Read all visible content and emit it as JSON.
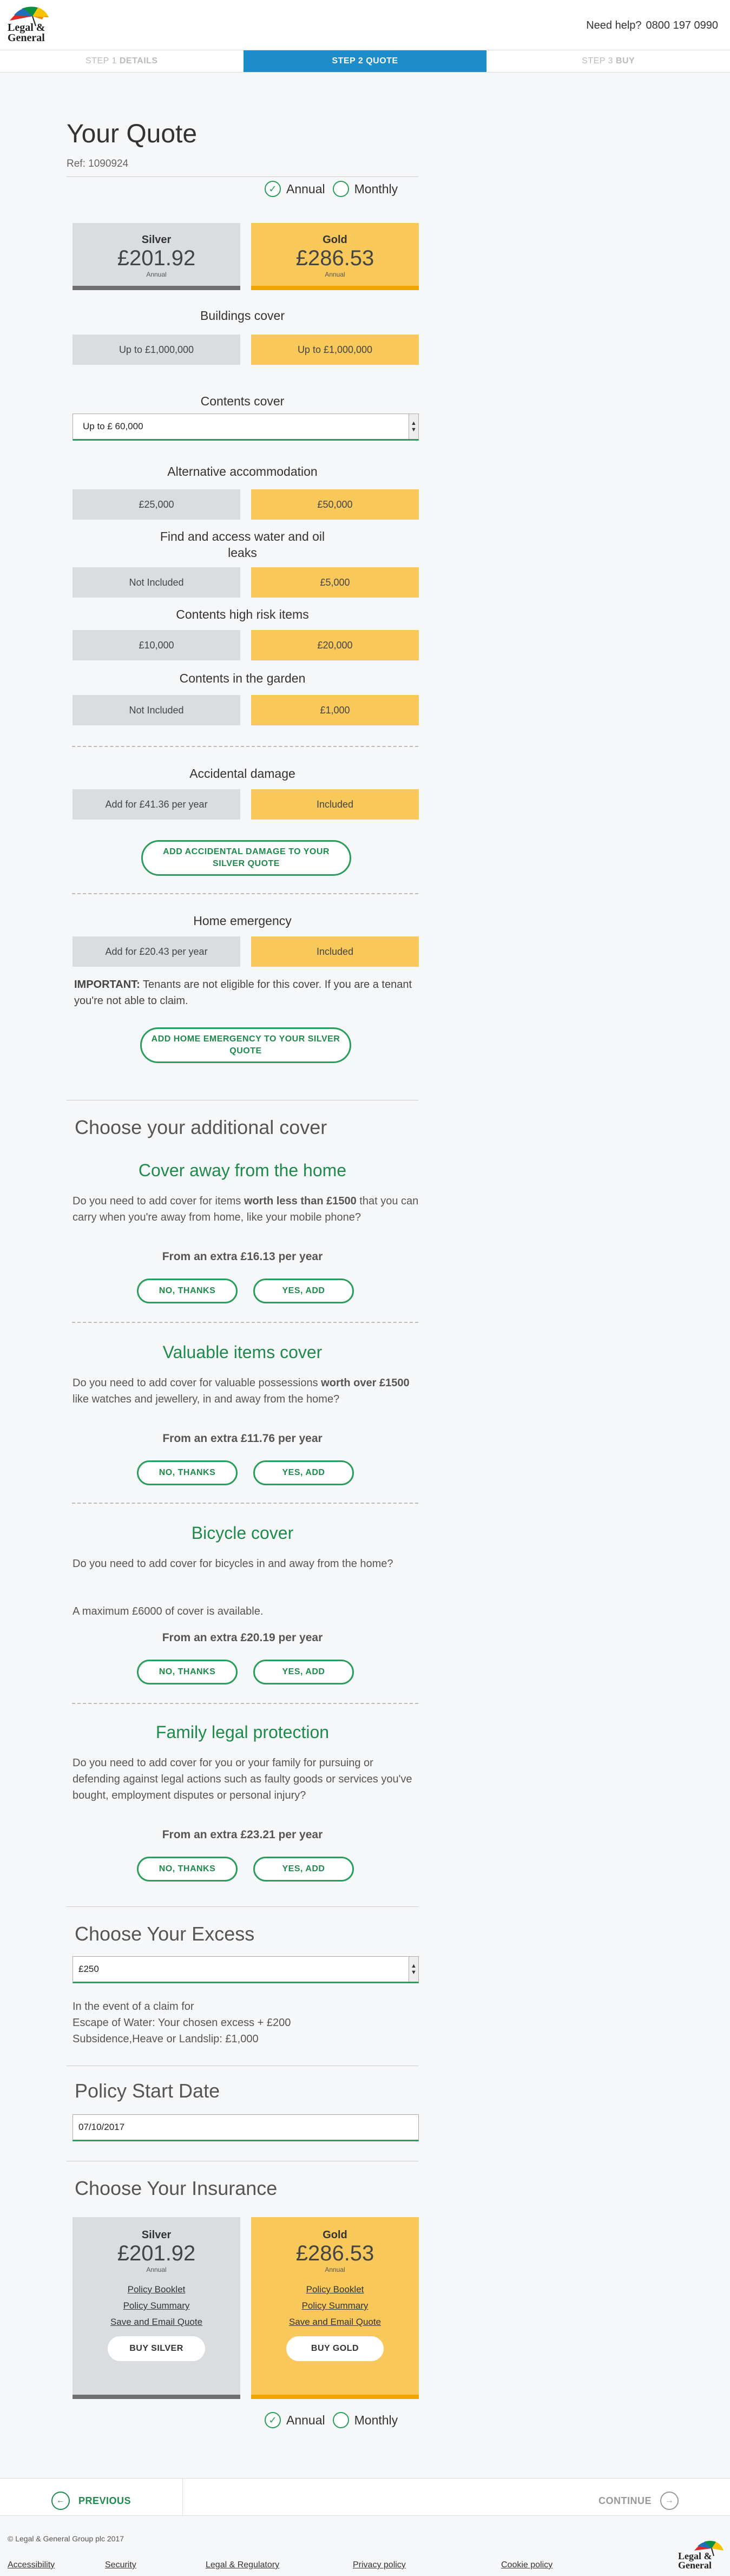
{
  "header": {
    "brand": "Legal & General",
    "help_label": "Need help?",
    "phone": "0800 197 0990"
  },
  "steps": [
    {
      "num": "STEP 1",
      "label": "DETAILS"
    },
    {
      "num": "STEP 2",
      "label": "QUOTE"
    },
    {
      "num": "STEP 3",
      "label": "BUY"
    }
  ],
  "quote": {
    "title": "Your Quote",
    "ref": "Ref: 1090924",
    "annual_label": "Annual",
    "monthly_label": "Monthly"
  },
  "plans": {
    "silver": {
      "name": "Silver",
      "price": "£201.92",
      "per": "Annual"
    },
    "gold": {
      "name": "Gold",
      "price": "£286.53",
      "per": "Annual"
    }
  },
  "features": {
    "buildings": {
      "label": "Buildings cover",
      "silver": "Up to £1,000,000",
      "gold": "Up to £1,000,000"
    },
    "contents": {
      "label": "Contents cover",
      "value": "Up to £ 60,000"
    },
    "alt_accom": {
      "label": "Alternative accommodation",
      "silver": "£25,000",
      "gold": "£50,000"
    },
    "water": {
      "label": "Find and access water and oil",
      "label2": "leaks",
      "silver": "Not Included",
      "gold": "£5,000"
    },
    "high_risk": {
      "label": "Contents high risk items",
      "silver": "£10,000",
      "gold": "£20,000"
    },
    "garden": {
      "label": "Contents in the garden",
      "silver": "Not Included",
      "gold": "£1,000"
    },
    "accidental": {
      "label": "Accidental damage",
      "silver": "Add for £41.36 per year",
      "gold": "Included",
      "button_line1": "ADD ACCIDENTAL DAMAGE TO YOUR",
      "button_line2": "SILVER QUOTE"
    },
    "emergency": {
      "label": "Home emergency",
      "silver": "Add for £20.43 per year",
      "gold": "Included",
      "button_line1": "ADD HOME EMERGENCY TO YOUR SILVER",
      "button_line2": "QUOTE"
    }
  },
  "important": {
    "bold": "IMPORTANT:",
    "text": " Tenants are not eligible for this cover. If you are a tenant you're not able to claim."
  },
  "additional": {
    "title": "Choose your additional cover",
    "no_label": "NO, THANKS",
    "yes_label": "YES, ADD",
    "away": {
      "title": "Cover away from the home",
      "text1": "Do you need to add cover for items ",
      "bold": "worth less than £1500",
      "text2": " that you can carry when you're away from home, like your mobile phone?",
      "price": "From an extra £16.13 per year"
    },
    "valuable": {
      "title": "Valuable items cover",
      "text1": "Do you need to add cover for valuable possessions ",
      "bold": "worth over £1500",
      "text2": " like watches and jewellery, in and away from the home?",
      "price": "From an extra £11.76 per year"
    },
    "bicycle": {
      "title": "Bicycle cover",
      "text": "Do you need to add cover for bicycles in and away from the home?",
      "text_b": "A maximum £6000 of cover is available.",
      "price": "From an extra £20.19 per year"
    },
    "legal": {
      "title": "Family legal protection",
      "text": "Do you need to add cover for you or your family for pursuing or defending against legal actions such as faulty goods or services you've bought, employment disputes or personal injury?",
      "price": "From an extra £23.21 per year"
    }
  },
  "excess": {
    "title": "Choose Your Excess",
    "value": "£250",
    "line1": "In the event of a claim for",
    "line2": "Escape of Water: Your chosen excess + £200",
    "line3": "Subsidence,Heave or Landslip: £1,000"
  },
  "start": {
    "title": "Policy Start Date",
    "value": "07/10/2017"
  },
  "insurance": {
    "title": "Choose Your Insurance",
    "policy_booklet": "Policy Booklet",
    "policy_summary": "Policy Summary",
    "save_email": "Save and Email Quote",
    "buy_silver": "BUY SILVER",
    "buy_gold": "BUY GOLD"
  },
  "nav": {
    "previous": "PREVIOUS",
    "continue": "CONTINUE"
  },
  "footer": {
    "copyright": "© Legal & General Group plc 2017",
    "links": [
      "Accessibility",
      "Security",
      "Legal & Regulatory",
      "Privacy policy",
      "Cookie policy"
    ]
  },
  "colors": {
    "green": "#2a9d5c",
    "blue": "#1e8cc9",
    "gold": "#f9c85a",
    "silver": "#dadde0"
  }
}
